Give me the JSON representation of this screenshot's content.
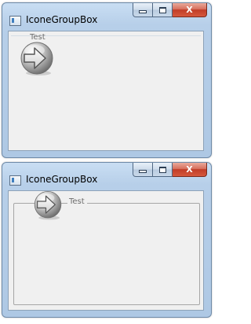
{
  "windows": [
    {
      "title": "IconeGroupBox",
      "caption_buttons": {
        "minimize": "minimize",
        "maximize": "maximize",
        "close": "X"
      },
      "groupbox": {
        "label": "Test",
        "icon": "right-arrow-icon"
      }
    },
    {
      "title": "IconeGroupBox",
      "caption_buttons": {
        "minimize": "minimize",
        "maximize": "maximize",
        "close": "X"
      },
      "groupbox": {
        "label": "Test",
        "icon": "right-arrow-icon"
      }
    }
  ],
  "colors": {
    "titlebar": "#b9d1ea",
    "client_bg": "#f0f0f0",
    "close_button": "#c13d27",
    "label_text": "#6d6d6d"
  }
}
